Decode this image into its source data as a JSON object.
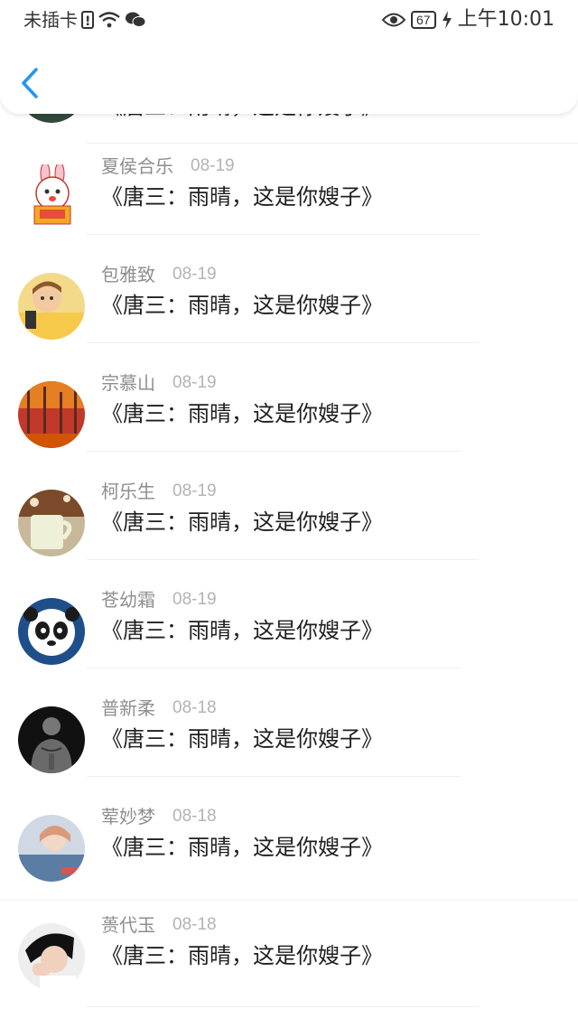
{
  "status_bar": {
    "carrier": "未插卡",
    "battery": "67",
    "time": "上午10:01"
  },
  "nav": {
    "back_icon": "chevron-left-icon",
    "accent": "#2196f3"
  },
  "list": {
    "items": [
      {
        "name": "",
        "date": "",
        "title": "《唐三：雨晴，这是你嫂子》"
      },
      {
        "name": "夏侯合乐",
        "date": "08-19",
        "title": "《唐三：雨晴，这是你嫂子》"
      },
      {
        "name": "包雅致",
        "date": "08-19",
        "title": "《唐三：雨晴，这是你嫂子》"
      },
      {
        "name": "宗慕山",
        "date": "08-19",
        "title": "《唐三：雨晴，这是你嫂子》"
      },
      {
        "name": "柯乐生",
        "date": "08-19",
        "title": "《唐三：雨晴，这是你嫂子》"
      },
      {
        "name": "苍幼霜",
        "date": "08-19",
        "title": "《唐三：雨晴，这是你嫂子》"
      },
      {
        "name": "普新柔",
        "date": "08-18",
        "title": "《唐三：雨晴，这是你嫂子》"
      },
      {
        "name": "荤妙梦",
        "date": "08-18",
        "title": "《唐三：雨晴，这是你嫂子》"
      },
      {
        "name": "蒉代玉",
        "date": "08-18",
        "title": "《唐三：雨晴，这是你嫂子》"
      }
    ]
  }
}
